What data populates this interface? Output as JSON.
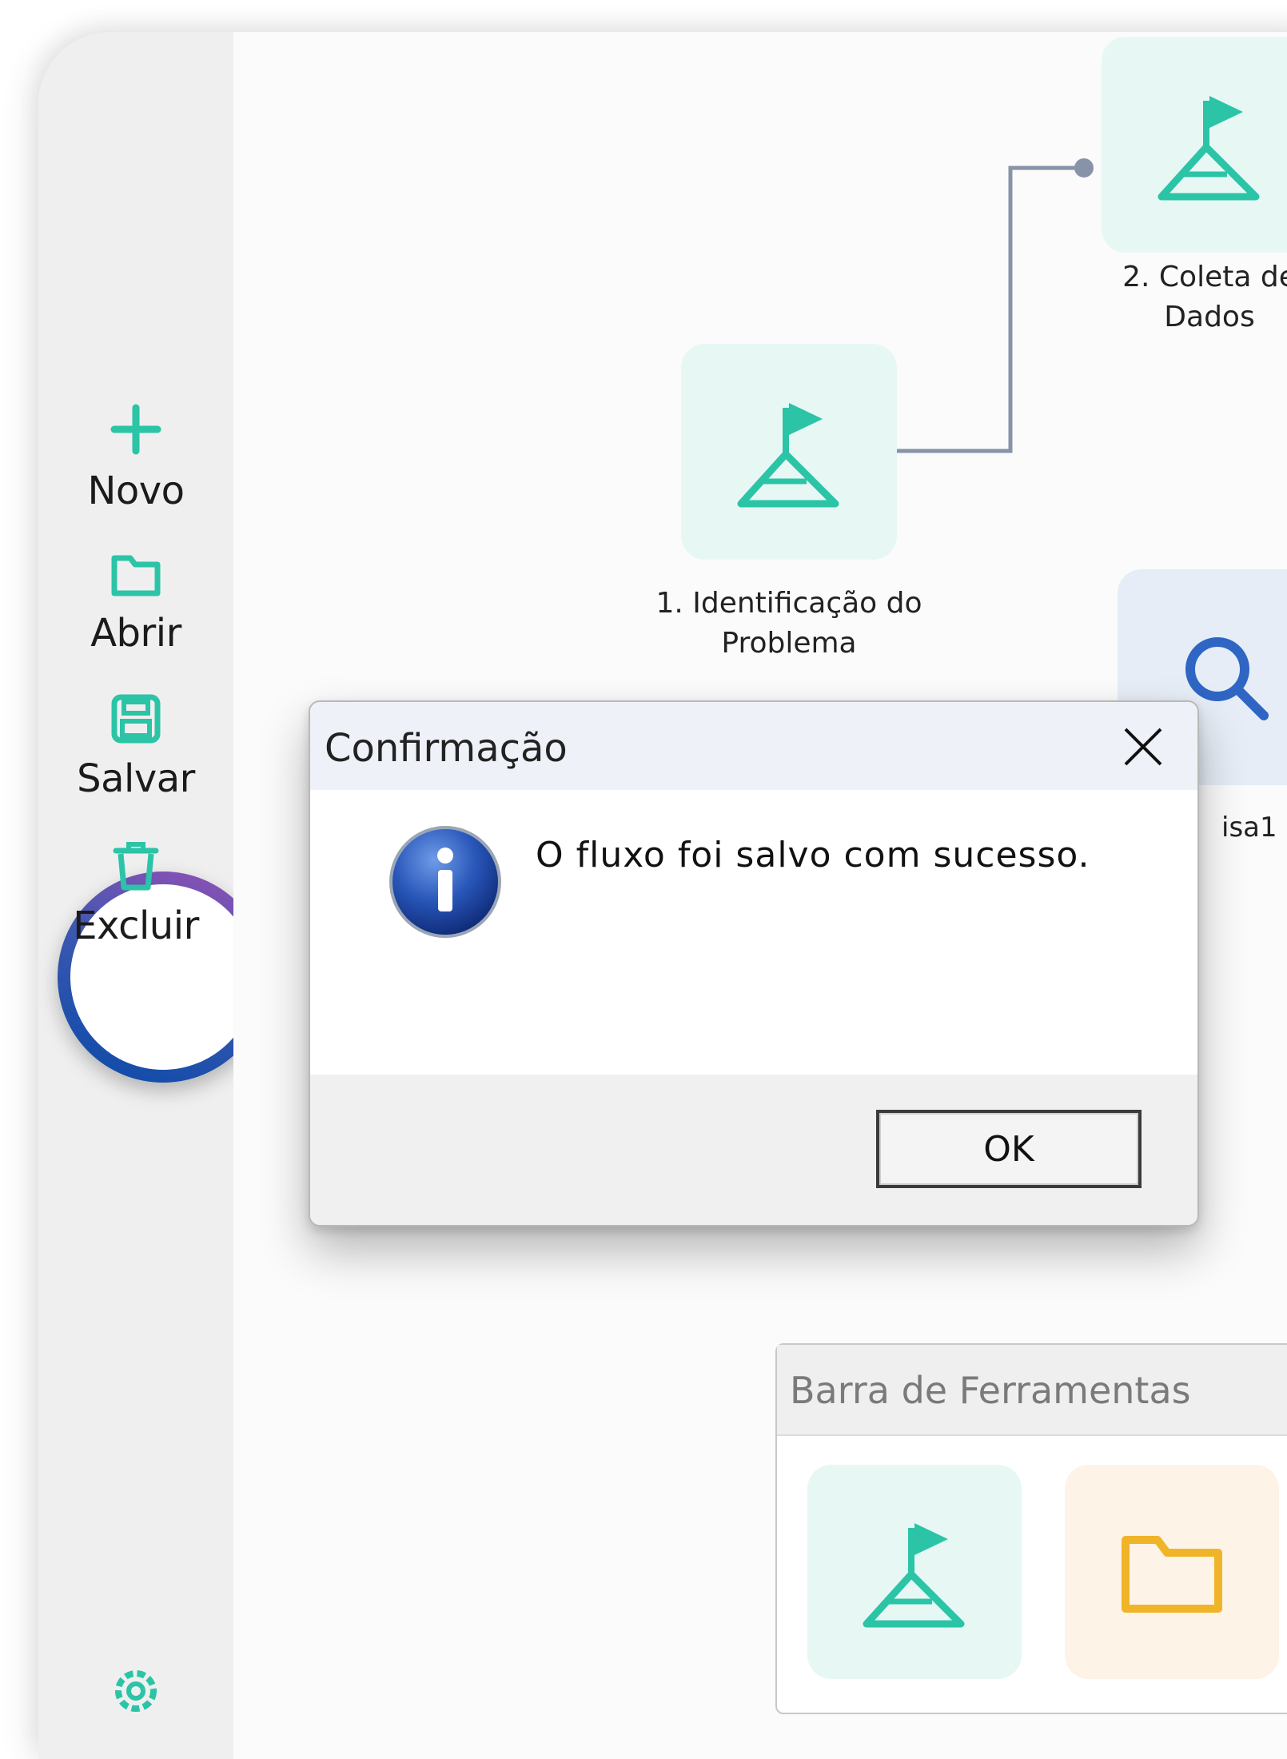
{
  "sidebar": {
    "items": [
      {
        "label": "Novo",
        "icon": "plus-icon"
      },
      {
        "label": "Abrir",
        "icon": "folder-icon"
      },
      {
        "label": "Salvar",
        "icon": "save-icon"
      },
      {
        "label": "Excluir",
        "icon": "trash-icon"
      }
    ],
    "settings_icon": "gear-icon"
  },
  "canvas": {
    "nodes": [
      {
        "label_line1": "1. Identificação do",
        "label_line2": "Problema",
        "icon": "flag-mountain-icon"
      },
      {
        "label_line1": "2. Coleta de",
        "label_line2": "Dados",
        "icon": "flag-mountain-icon"
      },
      {
        "label_partial": "isa1",
        "icon": "search-icon"
      }
    ]
  },
  "dialog": {
    "title": "Confirmação",
    "message": "O fluxo foi salvo com sucesso.",
    "ok_label": "OK",
    "icon": "info-icon"
  },
  "toolbar_panel": {
    "title": "Barra de Ferramentas",
    "tools": [
      {
        "icon": "flag-mountain-icon"
      },
      {
        "icon": "folder-icon"
      }
    ]
  },
  "colors": {
    "accent_teal": "#2bc4a6",
    "accent_blue": "#2f66c4",
    "accent_orange": "#f0b429",
    "highlight_ring": "#0a4aa8"
  }
}
